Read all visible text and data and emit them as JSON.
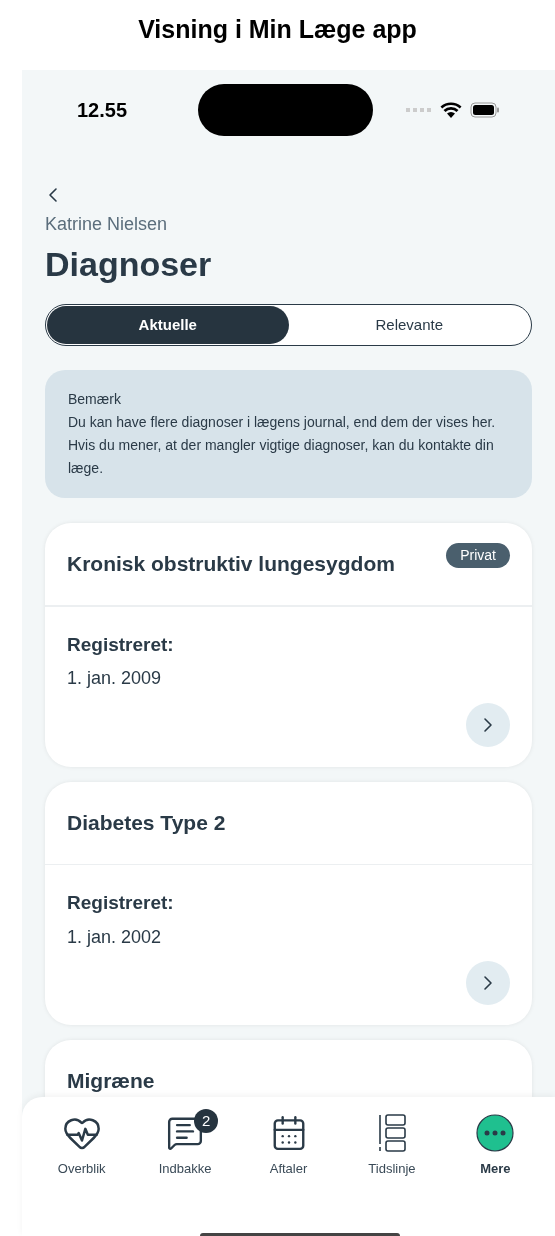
{
  "caption": "Visning i Min Læge app",
  "status_bar": {
    "time": "12.55"
  },
  "header": {
    "subtitle": "Katrine Nielsen",
    "title": "Diagnoser"
  },
  "segments": [
    {
      "label": "Aktuelle",
      "selected": true
    },
    {
      "label": "Relevante",
      "selected": false
    }
  ],
  "notice": {
    "title": "Bemærk",
    "text": "Du kan have flere diagnoser i lægens journal, end dem der vises her. Hvis du mener, at der mangler vigtige diagnoser, kan du kontakte din læge."
  },
  "cards": [
    {
      "title": "Kronisk obstruktiv lungesygdom",
      "badge": "Privat",
      "label": "Registreret:",
      "date": "1. jan. 2009"
    },
    {
      "title": "Diabetes Type 2",
      "label": "Registreret:",
      "date": "1. jan. 2002"
    },
    {
      "title": "Migræne"
    }
  ],
  "tab_bar": [
    {
      "kind": "heart",
      "label": "Overblik",
      "selected": false
    },
    {
      "kind": "inbox",
      "label": "Indbakke",
      "badge": "2",
      "selected": false
    },
    {
      "kind": "calendar",
      "label": "Aftaler",
      "selected": false
    },
    {
      "kind": "timeline",
      "label": "Tidslinje",
      "selected": false
    },
    {
      "kind": "more",
      "label": "Mere",
      "selected": true
    }
  ]
}
